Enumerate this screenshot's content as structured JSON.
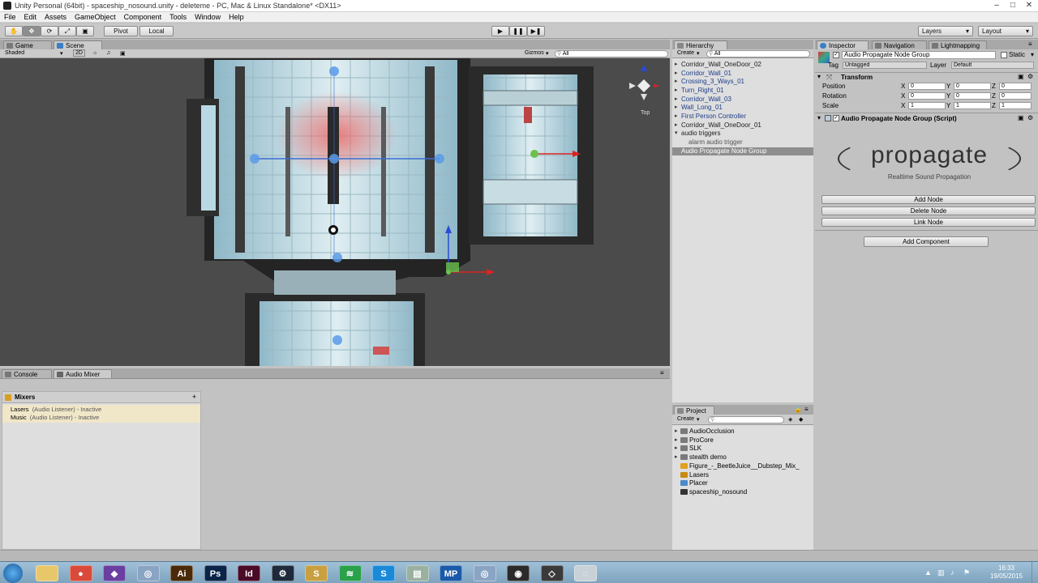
{
  "window": {
    "title": "Unity Personal (64bit) - spaceship_nosound.unity - deleteme - PC, Mac & Linux Standalone* <DX11>"
  },
  "menu": [
    "File",
    "Edit",
    "Assets",
    "GameObject",
    "Component",
    "Tools",
    "Window",
    "Help"
  ],
  "toolbar": {
    "pivot": "Pivot",
    "local": "Local",
    "layers": "Layers",
    "layout": "Layout"
  },
  "scene": {
    "tab_game": "Game",
    "tab_scene": "Scene",
    "shaded": "Shaded",
    "mode_2d": "2D",
    "gizmos": "Gizmos",
    "search": "All",
    "gizmo_label": "Top"
  },
  "hierarchy": {
    "tab": "Hierarchy",
    "create": "Create",
    "search": "All",
    "items": [
      {
        "label": "Corridor_Wall_OneDoor_02",
        "indent": 0,
        "arrow": "▸",
        "color": "#1a1a1a"
      },
      {
        "label": "Corridor_Wall_01",
        "indent": 0,
        "arrow": "▸",
        "color": "#1c3c8a"
      },
      {
        "label": "Crossing_3_Ways_01",
        "indent": 0,
        "arrow": "▸",
        "color": "#1c3c8a"
      },
      {
        "label": "Turn_Right_01",
        "indent": 0,
        "arrow": "▸",
        "color": "#1c3c8a"
      },
      {
        "label": "Corridor_Wall_03",
        "indent": 0,
        "arrow": "▸",
        "color": "#1c3c8a"
      },
      {
        "label": "Wall_Long_01",
        "indent": 0,
        "arrow": "▸",
        "color": "#1c3c8a"
      },
      {
        "label": "First Person Controller",
        "indent": 0,
        "arrow": "▸",
        "color": "#1c3c8a"
      },
      {
        "label": "Corridor_Wall_OneDoor_01",
        "indent": 0,
        "arrow": "▸",
        "color": "#1a1a1a"
      },
      {
        "label": "audio triggers",
        "indent": 0,
        "arrow": "▾",
        "color": "#1a1a1a"
      },
      {
        "label": "alarm audio trigger",
        "indent": 1,
        "arrow": "",
        "color": "#555555"
      },
      {
        "label": "Audio Propagate Node Group",
        "indent": 0,
        "arrow": "",
        "color": "#ffffff",
        "selected": true
      }
    ]
  },
  "project": {
    "tab": "Project",
    "create": "Create",
    "items": [
      {
        "label": "AudioOcclusion",
        "kind": "folder"
      },
      {
        "label": "ProCore",
        "kind": "folder"
      },
      {
        "label": "SLK",
        "kind": "folder"
      },
      {
        "label": "stealth demo",
        "kind": "folder"
      },
      {
        "label": "Figure_-_BeetleJuice__Dubstep_Mix_",
        "kind": "audio"
      },
      {
        "label": "Lasers",
        "kind": "mixer"
      },
      {
        "label": "Placer",
        "kind": "script"
      },
      {
        "label": "spaceship_nosound",
        "kind": "scene"
      }
    ]
  },
  "console": {
    "tab_console": "Console",
    "tab_mixer": "Audio Mixer",
    "mixers_title": "Mixers",
    "add": "+",
    "mixers": [
      {
        "name": "Lasers",
        "status": "(Audio Listener) - Inactive"
      },
      {
        "name": "Music",
        "status": "(Audio Listener) - Inactive"
      }
    ]
  },
  "inspector": {
    "tabs": [
      "Inspector",
      "Navigation",
      "Lightmapping"
    ],
    "object_name": "Audio Propagate Node Group",
    "static": "Static",
    "tag_label": "Tag",
    "tag_value": "Untagged",
    "layer_label": "Layer",
    "layer_value": "Default",
    "transform": {
      "title": "Transform",
      "rows": [
        {
          "label": "Position",
          "x": "0",
          "y": "0",
          "z": "0"
        },
        {
          "label": "Rotation",
          "x": "0",
          "y": "0",
          "z": "0"
        },
        {
          "label": "Scale",
          "x": "1",
          "y": "1",
          "z": "1"
        }
      ]
    },
    "script_title": "Audio Propagate Node Group (Script)",
    "logo_text": "propagate",
    "logo_sub": "Realtime Sound Propagation",
    "buttons": [
      "Add Node",
      "Delete Node",
      "Link Node"
    ],
    "add_component": "Add Component"
  },
  "taskbar": {
    "time": "16:33",
    "date": "19/05/2015",
    "apps": [
      {
        "name": "explorer",
        "glyph": "",
        "color": "#e8c66a"
      },
      {
        "name": "chrome",
        "glyph": "●",
        "color": "#d94a3a"
      },
      {
        "name": "visual-studio",
        "glyph": "◆",
        "color": "#6a3fa0"
      },
      {
        "name": "app",
        "glyph": "◎",
        "color": "#8aa4c4"
      },
      {
        "name": "illustrator",
        "glyph": "Ai",
        "color": "#4a2a08"
      },
      {
        "name": "photoshop",
        "glyph": "Ps",
        "color": "#0a2448"
      },
      {
        "name": "indesign",
        "glyph": "Id",
        "color": "#4a0a28"
      },
      {
        "name": "steam",
        "glyph": "⚙",
        "color": "#1e2a3a"
      },
      {
        "name": "app",
        "glyph": "S",
        "color": "#c8a040"
      },
      {
        "name": "spotify",
        "glyph": "≋",
        "color": "#2aa14a"
      },
      {
        "name": "skype",
        "glyph": "S",
        "color": "#1a8ad8"
      },
      {
        "name": "app",
        "glyph": "▤",
        "color": "#9ab0a0"
      },
      {
        "name": "mp",
        "glyph": "MP",
        "color": "#1a5aa8"
      },
      {
        "name": "app",
        "glyph": "◎",
        "color": "#8aa4c4"
      },
      {
        "name": "obs",
        "glyph": "◉",
        "color": "#2a2a2a"
      },
      {
        "name": "unity",
        "glyph": "◇",
        "color": "#3a3a3a"
      },
      {
        "name": "app",
        "glyph": "◌",
        "color": "#c8d0d8"
      }
    ]
  }
}
